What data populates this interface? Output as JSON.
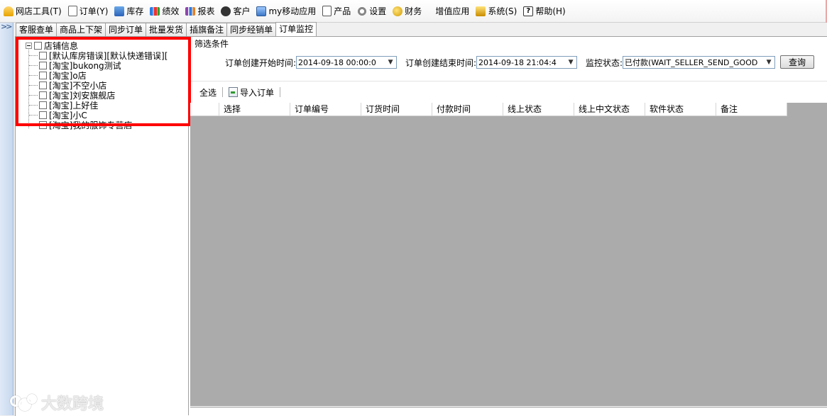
{
  "menu": [
    {
      "icon": "shop-icon",
      "label": "网店工具(T)"
    },
    {
      "icon": "order-icon",
      "label": "订单(Y)"
    },
    {
      "icon": "store-icon",
      "label": "库存"
    },
    {
      "icon": "performance-icon",
      "label": "绩效"
    },
    {
      "icon": "report-icon",
      "label": "报表"
    },
    {
      "icon": "customer-icon",
      "label": "客户"
    },
    {
      "icon": "mobile-app-icon",
      "label": "my移动应用"
    },
    {
      "icon": "product-icon",
      "label": "产品"
    },
    {
      "icon": "settings-icon",
      "label": "设置"
    },
    {
      "icon": "finance-icon",
      "label": "财务"
    },
    {
      "icon": "",
      "label": "增值应用"
    },
    {
      "icon": "system-icon",
      "label": "系统(S)"
    },
    {
      "icon": "help-icon",
      "label": "帮助(H)"
    }
  ],
  "side_toggle": ">>",
  "tabs": [
    "客服查单",
    "商品上下架",
    "同步订单",
    "批量发货",
    "插旗备注",
    "同步经销单",
    "订单监控"
  ],
  "active_tab": "订单监控",
  "tree": {
    "root": "店铺信息",
    "items": [
      "[默认库房错误][默认快递错误][",
      "[淘宝]bukong测试",
      "[淘宝]o店",
      "[淘宝]不空小店",
      "[淘宝]刘安旗舰店",
      "[淘宝]上好佳",
      "[淘宝]小C",
      "[淘宝]我的服饰专营店"
    ]
  },
  "filter": {
    "title": "筛选条件",
    "start_label": "订单创建开始时间:",
    "start_value": "2014-09-18 00:00:0",
    "end_label": "订单创建结束时间:",
    "end_value": "2014-09-18 21:04:4",
    "status_label": "监控状态:",
    "status_value": "已付款(WAIT_SELLER_SEND_GOOD",
    "query_button": "查询"
  },
  "toolbar": {
    "select_all": "全选",
    "import_orders": "导入订单"
  },
  "grid": {
    "columns": [
      "选择",
      "订单编号",
      "订货时间",
      "付款时间",
      "线上状态",
      "线上中文状态",
      "软件状态",
      "备注"
    ]
  },
  "watermark": "大数跨境",
  "colors": {
    "highlight": "#ff0000",
    "grid_bg": "#ababab"
  }
}
